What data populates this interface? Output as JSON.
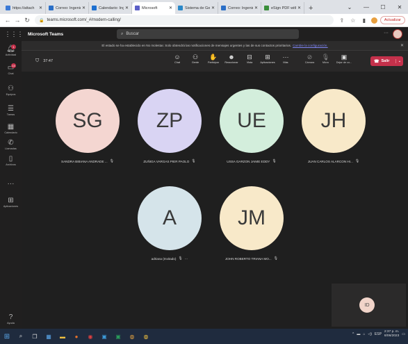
{
  "browser": {
    "tabs": [
      {
        "label": "https://attach",
        "color": "#3c7ad6"
      },
      {
        "label": "Correo: Ingenie",
        "color": "#2b6fc7"
      },
      {
        "label": "Calendario: Ing",
        "color": "#1d6fd0"
      },
      {
        "label": "Microsoft",
        "color": "#5b5fc7",
        "active": true
      },
      {
        "label": "Sistema de Ge",
        "color": "#2a88c8"
      },
      {
        "label": "Correo: Ingenie",
        "color": "#2b6fc7"
      },
      {
        "label": "eSign PDF with",
        "color": "#3a8f3a"
      }
    ],
    "url": "teams.microsoft.com/_#/modern-calling/",
    "update_label": "Actualizar"
  },
  "teams": {
    "brand": "Microsoft Teams",
    "search_placeholder": "Buscar",
    "rail": [
      {
        "label": "Actividad",
        "icon": "bell-icon",
        "badge": "1"
      },
      {
        "label": "Chat",
        "icon": "chat-icon",
        "badge": "14"
      },
      {
        "label": "Equipos",
        "icon": "teams-icon"
      },
      {
        "label": "Tareas",
        "icon": "tasks-icon"
      },
      {
        "label": "Calendario",
        "icon": "calendar-icon"
      },
      {
        "label": "Llamadas",
        "icon": "phone-icon"
      },
      {
        "label": "Archivos",
        "icon": "file-icon"
      },
      {
        "label": "...",
        "icon": "more-icon"
      },
      {
        "label": "Aplicaciones",
        "icon": "apps-icon"
      },
      {
        "label": "Ayuda",
        "icon": "help-icon"
      }
    ],
    "notification": {
      "text": "El estado se ha establecido en No molestar. Solo obtendrá las notificaciones de mensajes urgentes y las de sus contactos prioritarios.",
      "link": "Cambie la configuración."
    },
    "meeting": {
      "timer": "37:47",
      "buttons": [
        "Chat",
        "Gente",
        "Participar",
        "Reaccionar",
        "Vista",
        "Aplicaciones",
        "Más"
      ],
      "buttons2": [
        "Cámara",
        "Micro",
        "Dejar de co..."
      ],
      "leave_label": "Salir"
    },
    "participants": [
      {
        "initials": "SG",
        "name": "SANDRA BIBIANA ANDRADE ...",
        "color": "#f4d6d1"
      },
      {
        "initials": "ZP",
        "name": "ZUÑIGA VARGAS PIER PAOLO",
        "color": "#d9d4f3"
      },
      {
        "initials": "UE",
        "name": "USSA GARZON JAIME EDDY",
        "color": "#d3eedc"
      },
      {
        "initials": "JH",
        "name": "JUAN CARLOS ALARCON HI...",
        "color": "#f8e9c9"
      },
      {
        "initials": "A",
        "name": "adriana (Invitado)",
        "color": "#d5e4ea"
      },
      {
        "initials": "JM",
        "name": "JOHN ROBERTO TRIANA MO...",
        "color": "#f8e9c9"
      }
    ],
    "self_initials": "ID"
  },
  "taskbar": {
    "lang": "ESP",
    "time": "2:37 p. m.",
    "date": "8/06/2023"
  }
}
